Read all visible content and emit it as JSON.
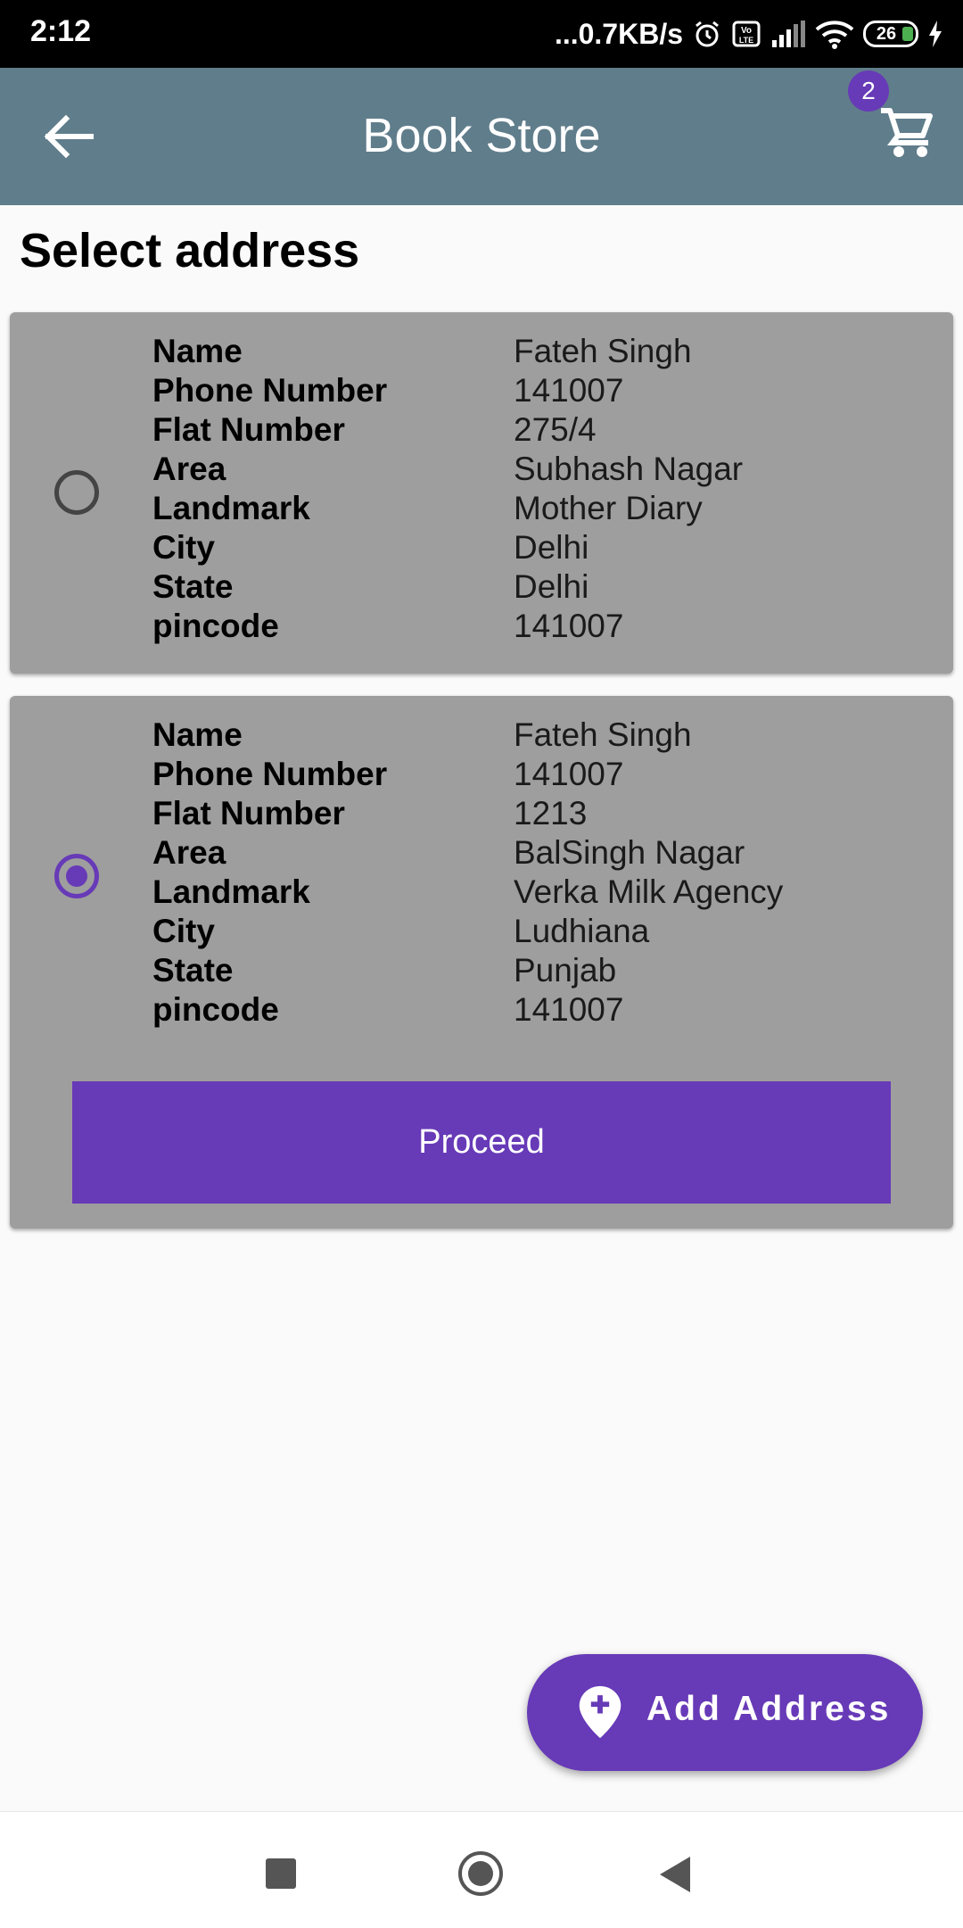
{
  "status_bar": {
    "time": "2:12",
    "speed": "...0.7KB/s",
    "battery": "26"
  },
  "app_bar": {
    "title": "Book Store",
    "cart_count": "2"
  },
  "page": {
    "heading": "Select address"
  },
  "addresses": [
    {
      "selected": false,
      "rows": [
        {
          "label": "Name",
          "value": "Fateh Singh"
        },
        {
          "label": "Phone Number",
          "value": "141007"
        },
        {
          "label": "Flat Number",
          "value": "275/4"
        },
        {
          "label": "Area",
          "value": "Subhash Nagar"
        },
        {
          "label": "Landmark",
          "value": "Mother Diary"
        },
        {
          "label": "City",
          "value": "Delhi"
        },
        {
          "label": "State",
          "value": "Delhi"
        },
        {
          "label": "pincode",
          "value": "141007"
        }
      ]
    },
    {
      "selected": true,
      "rows": [
        {
          "label": "Name",
          "value": "Fateh Singh"
        },
        {
          "label": "Phone Number",
          "value": "141007"
        },
        {
          "label": "Flat Number",
          "value": "1213"
        },
        {
          "label": "Area",
          "value": "BalSingh Nagar"
        },
        {
          "label": "Landmark",
          "value": "Verka Milk Agency"
        },
        {
          "label": "City",
          "value": "Ludhiana"
        },
        {
          "label": "State",
          "value": "Punjab"
        },
        {
          "label": "pincode",
          "value": "141007"
        }
      ]
    }
  ],
  "proceed_label": "Proceed",
  "fab": {
    "label": "Add Address",
    "icon": "add-location-icon"
  },
  "colors": {
    "app_bar": "#607d8b",
    "accent": "#673ab7",
    "card": "#9e9e9e"
  }
}
